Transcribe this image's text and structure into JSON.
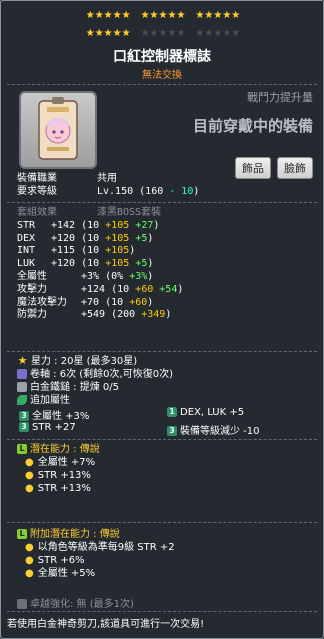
{
  "stars": {
    "filled": 20,
    "total": 30
  },
  "item": {
    "name": "口紅控制器標誌",
    "trade_status": "無法交換",
    "combat_label": "戰鬥力提升量",
    "equip_status": "目前穿戴中的裝備",
    "btn_accessory": "飾品",
    "btn_face": "臉飾"
  },
  "requirements": {
    "job_label": "裝備職業",
    "job_value": "共用",
    "level_label": "要求等級",
    "level_value": "Lv.150",
    "level_paren_open": "(160 ",
    "level_minus": "- 10",
    "level_paren_close": ")"
  },
  "set": {
    "label": "套組效果",
    "name": "漆黑BOSS套裝"
  },
  "stats": [
    {
      "name": "STR",
      "total": "+142",
      "base": "(10 ",
      "bonus": "+105",
      "star": " +27",
      "close": ")"
    },
    {
      "name": "DEX",
      "total": "+120",
      "base": "(10 ",
      "bonus": "+105",
      "star": " +5",
      "close": ")"
    },
    {
      "name": "INT",
      "total": "+115",
      "base": "(10 ",
      "bonus": "+105",
      "star": "",
      "close": ")"
    },
    {
      "name": "LUK",
      "total": "+120",
      "base": "(10 ",
      "bonus": "+105",
      "star": " +5",
      "close": ")"
    }
  ],
  "stats2": [
    {
      "name": "全屬性",
      "total": "+3%",
      "base": "(0% ",
      "bonus": "",
      "star": "+3%",
      "close": ")"
    },
    {
      "name": "攻擊力",
      "total": "+124",
      "base": "(10 ",
      "bonus": "+60",
      "star": " +54",
      "close": ")"
    },
    {
      "name": "魔法攻擊力",
      "total": "+70",
      "base": "(10 ",
      "bonus": "+60",
      "star": "",
      "close": ")"
    },
    {
      "name": "防禦力",
      "total": "+549",
      "base": "(200 ",
      "bonus": "+349",
      "star": "",
      "close": ")"
    }
  ],
  "enhance": {
    "starforce": "星力 : 20星 (最多30星)",
    "scroll": "卷軸 : 6次 (剩餘0次,可恢復0次)",
    "hammer": "白金鐵鎚 : 提煉 0/5",
    "extra_title": "追加屬性"
  },
  "set_bonus": [
    {
      "left": "全屬性 +3%",
      "right": "DEX, LUK  +5"
    },
    {
      "left": "STR  +27",
      "right": "裝備等級減少  -10"
    }
  ],
  "potential": {
    "title_label": "潛在能力 : ",
    "title_grade": "傳說",
    "lines": [
      "全屬性 +7%",
      "STR +13%",
      "STR +13%"
    ]
  },
  "bonus_potential": {
    "title_label": "附加潛在能力 : ",
    "title_grade": "傳說",
    "lines": [
      "以角色等級為準每9級 STR +2",
      "STR +6%",
      "全屬性 +5%"
    ]
  },
  "exceptional": "卓越強化:  無 (最多1次)",
  "footer": "若使用白金神奇剪刀,該道具可進行一次交易!",
  "colors": {
    "star": "#ffcc33",
    "bonus": "#ffcc00",
    "starforce": "#66ff66",
    "epic_bonus": "#99b3ff",
    "legendary": "#88cc33",
    "untradeable": "#ff9933"
  },
  "icons": {
    "item": "lipstick-controller-badge",
    "starforce": "star-icon",
    "scroll": "scroll-icon",
    "hammer": "hammer-icon",
    "extra": "leaf-icon",
    "potential": "legendary-grade-icon"
  }
}
